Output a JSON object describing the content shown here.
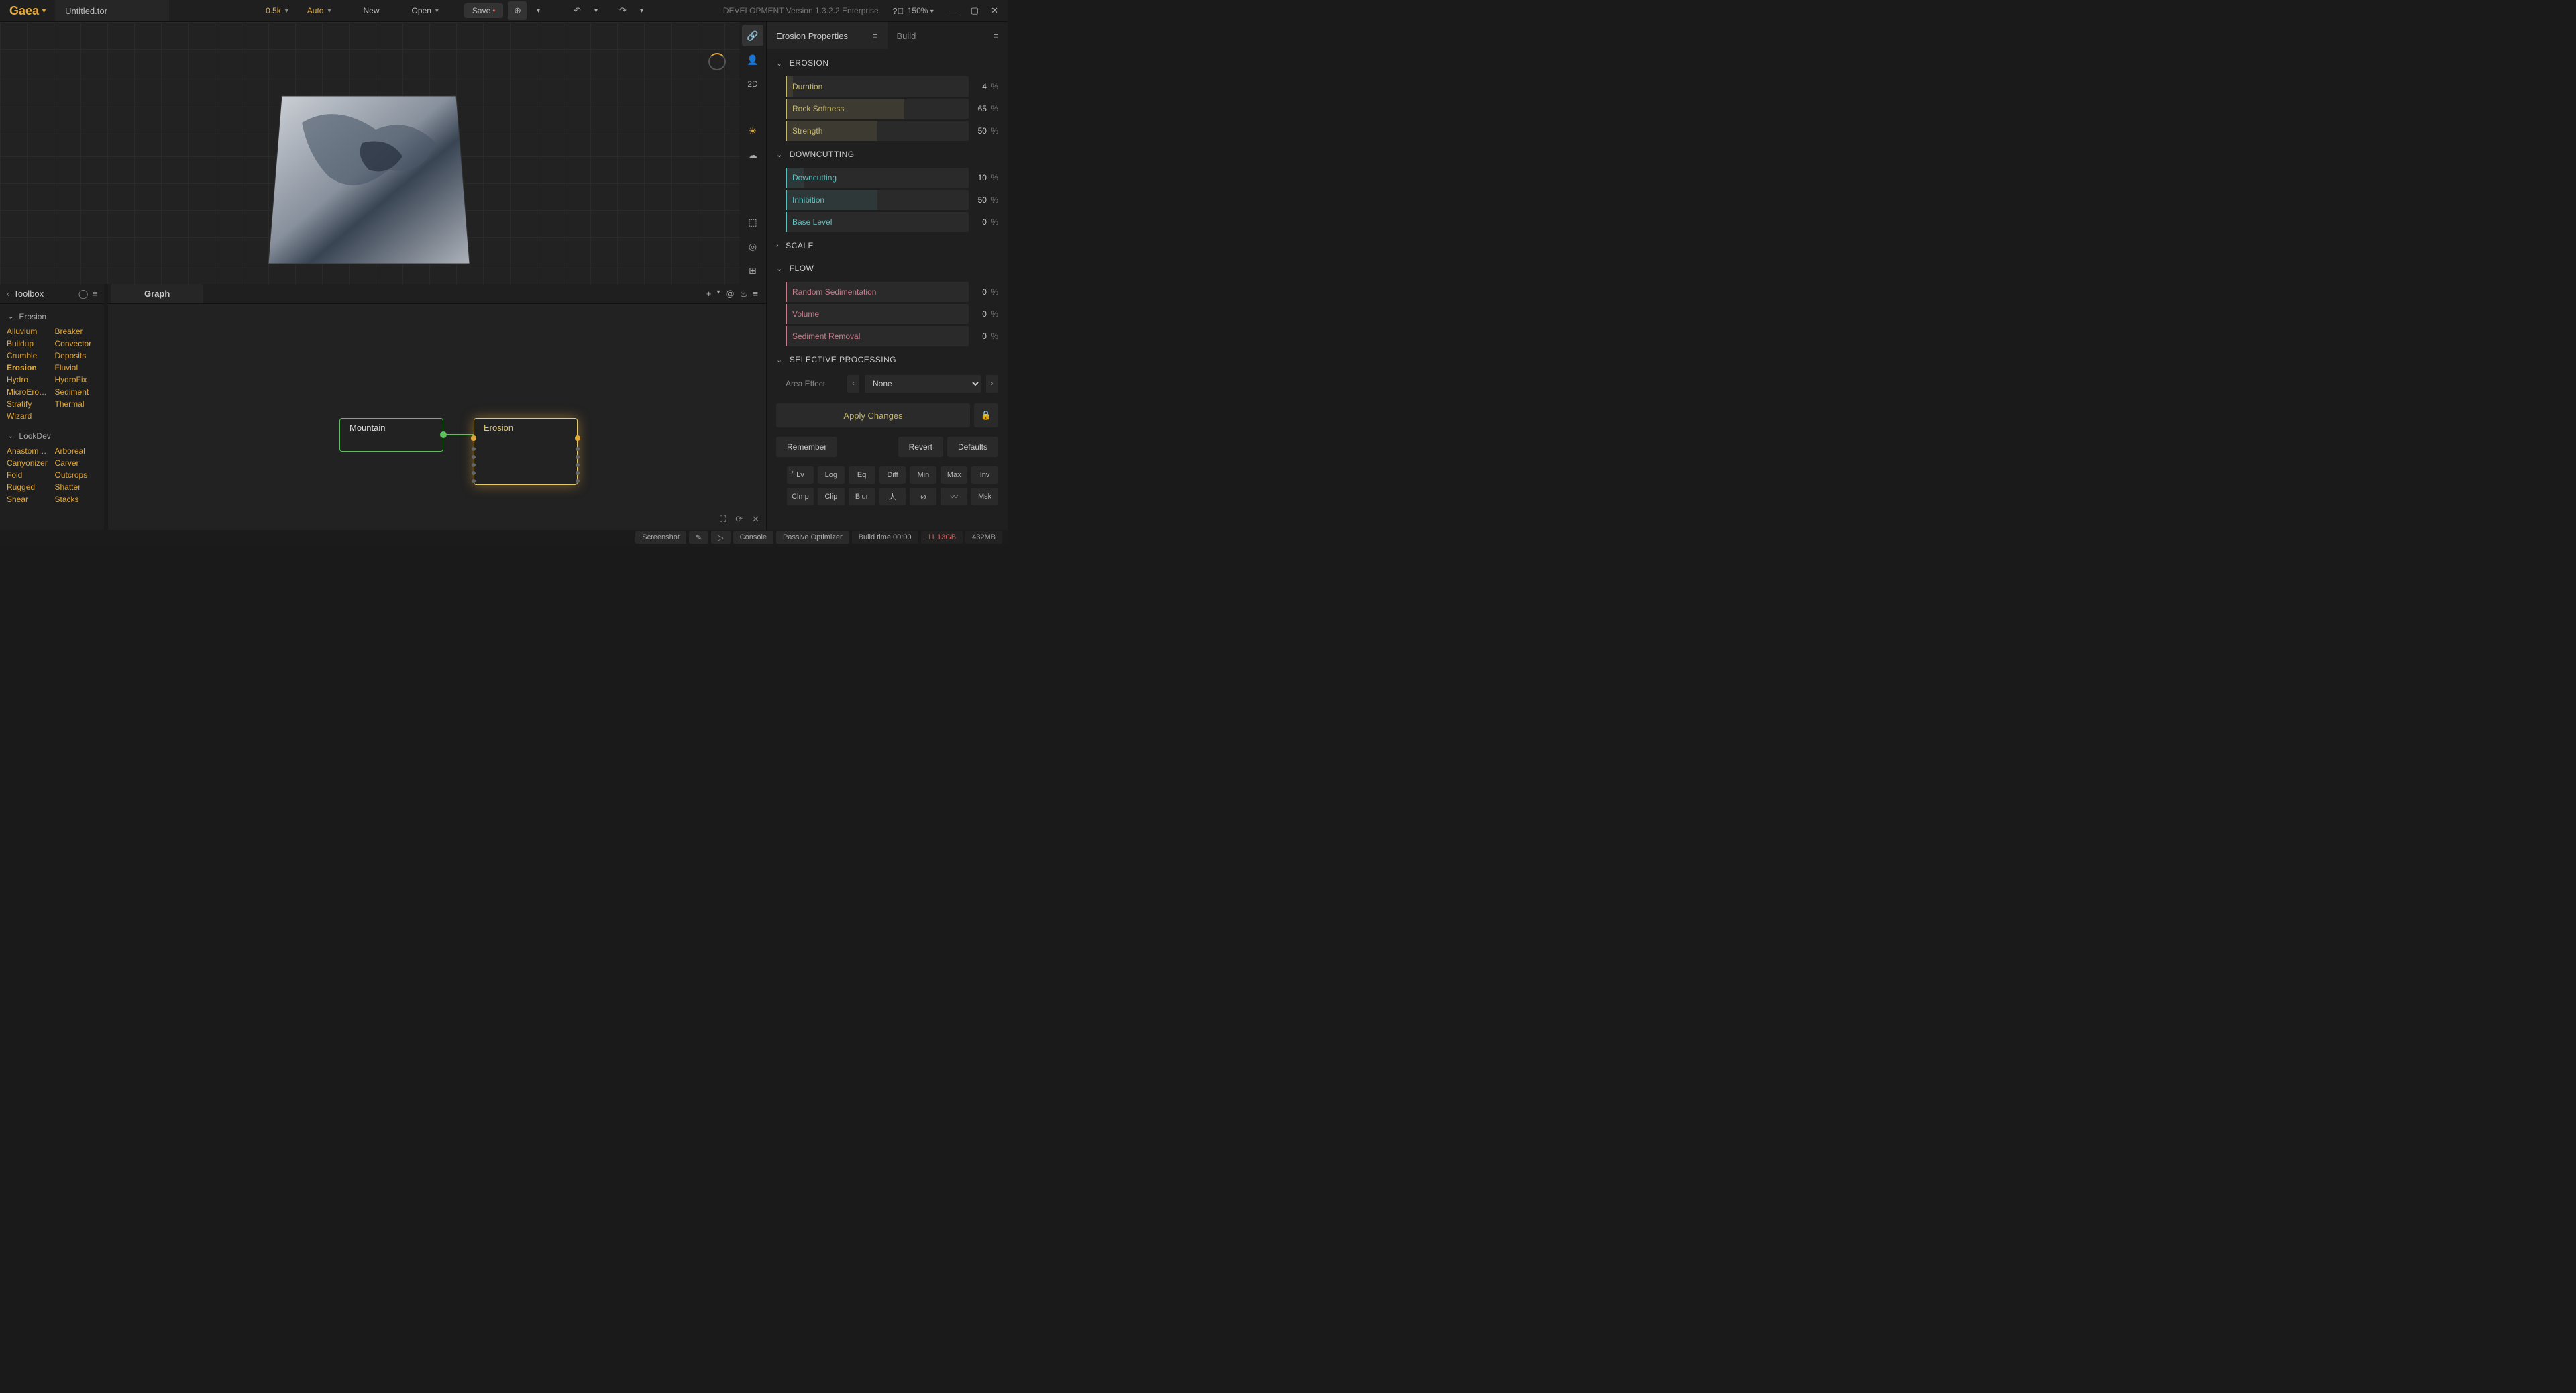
{
  "app": {
    "name": "Gaea",
    "filename": "Untitled.tor",
    "resolution": "0.5k",
    "auto": "Auto",
    "new": "New",
    "open": "Open",
    "save": "Save",
    "version": "DEVELOPMENT Version 1.3.2.2 Enterprise",
    "zoom": "150%"
  },
  "viewport_side": {
    "mode2d": "2D"
  },
  "toolbox": {
    "title": "Toolbox",
    "sections": {
      "erosion": {
        "title": "Erosion",
        "items": [
          "Alluvium",
          "Breaker",
          "Buildup",
          "Convector",
          "Crumble",
          "Deposits",
          "Erosion",
          "Fluvial",
          "Hydro",
          "HydroFix",
          "MicroEros…",
          "Sediment",
          "Stratify",
          "Thermal",
          "Wizard"
        ]
      },
      "lookdev": {
        "title": "LookDev",
        "items": [
          "Anastom…",
          "Arboreal",
          "Canyonizer",
          "Carver",
          "Fold",
          "Outcrops",
          "Rugged",
          "Shatter",
          "Shear",
          "Stacks"
        ]
      }
    }
  },
  "graph": {
    "tab": "Graph",
    "nodes": {
      "mountain": "Mountain",
      "erosion": "Erosion"
    }
  },
  "props": {
    "tab_active": "Erosion Properties",
    "tab_inactive": "Build",
    "erosion": {
      "title": "EROSION",
      "duration": {
        "label": "Duration",
        "value": "4",
        "pct": 4
      },
      "rock_softness": {
        "label": "Rock Softness",
        "value": "65",
        "pct": 65
      },
      "strength": {
        "label": "Strength",
        "value": "50",
        "pct": 50
      }
    },
    "downcutting": {
      "title": "DOWNCUTTING",
      "downcutting": {
        "label": "Downcutting",
        "value": "10",
        "pct": 10
      },
      "inhibition": {
        "label": "Inhibition",
        "value": "50",
        "pct": 50
      },
      "base_level": {
        "label": "Base Level",
        "value": "0",
        "pct": 0
      }
    },
    "scale": {
      "title": "SCALE"
    },
    "flow": {
      "title": "FLOW",
      "random_sed": {
        "label": "Random Sedimentation",
        "value": "0",
        "pct": 0
      },
      "volume": {
        "label": "Volume",
        "value": "0",
        "pct": 0
      },
      "sed_removal": {
        "label": "Sediment Removal",
        "value": "0",
        "pct": 0
      }
    },
    "selective": {
      "title": "SELECTIVE PROCESSING",
      "area_effect_label": "Area Effect",
      "area_effect_value": "None"
    },
    "apply": "Apply Changes",
    "remember": "Remember",
    "revert": "Revert",
    "defaults": "Defaults",
    "filters": [
      "Lv",
      "Log",
      "Eq",
      "Diff",
      "Min",
      "Max",
      "Inv",
      "Clmp",
      "Clip",
      "Blur",
      "人",
      "⊘",
      "〰",
      "Msk"
    ]
  },
  "status": {
    "screenshot": "Screenshot",
    "console": "Console",
    "optimizer": "Passive Optimizer",
    "build_time": "Build time 00:00",
    "gpu": "11.13GB",
    "mem": "432MB"
  }
}
